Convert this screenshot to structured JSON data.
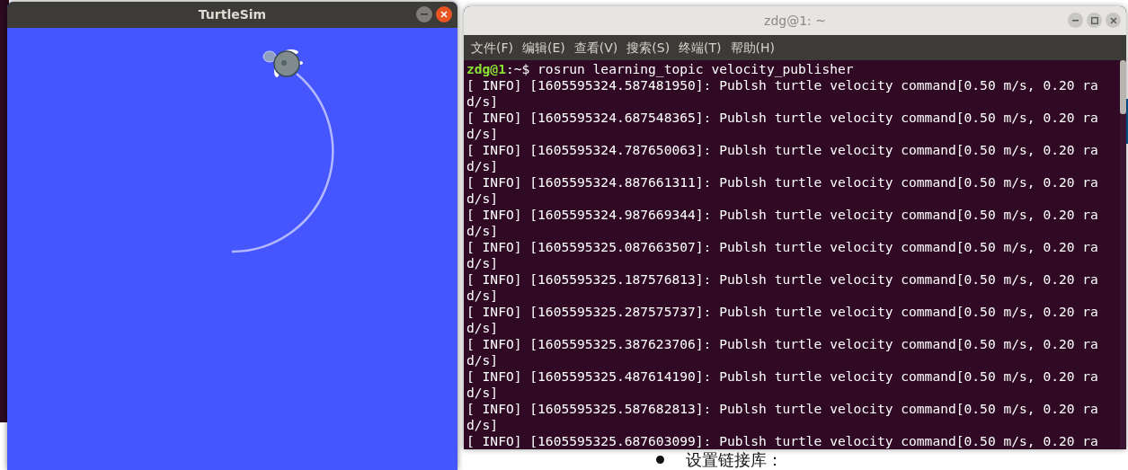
{
  "turtlesim_window": {
    "title": "TurtleSim",
    "active": true
  },
  "terminal_window": {
    "title": "zdg@1: ~",
    "active": false,
    "menu": [
      "文件(F)",
      "编辑(E)",
      "查看(V)",
      "搜索(S)",
      "终端(T)",
      "帮助(H)"
    ],
    "prompt": {
      "user_host": "zdg@1",
      "path": ":~$",
      "command": "rosrun learning_topic velocity_publisher"
    },
    "log_lines": [
      "[ INFO] [1605595324.587481950]: Publsh turtle velocity command[0.50 m/s, 0.20 rad/s]",
      "[ INFO] [1605595324.687548365]: Publsh turtle velocity command[0.50 m/s, 0.20 rad/s]",
      "[ INFO] [1605595324.787650063]: Publsh turtle velocity command[0.50 m/s, 0.20 rad/s]",
      "[ INFO] [1605595324.887661311]: Publsh turtle velocity command[0.50 m/s, 0.20 rad/s]",
      "[ INFO] [1605595324.987669344]: Publsh turtle velocity command[0.50 m/s, 0.20 rad/s]",
      "[ INFO] [1605595325.087663507]: Publsh turtle velocity command[0.50 m/s, 0.20 rad/s]",
      "[ INFO] [1605595325.187576813]: Publsh turtle velocity command[0.50 m/s, 0.20 rad/s]",
      "[ INFO] [1605595325.287575737]: Publsh turtle velocity command[0.50 m/s, 0.20 rad/s]",
      "[ INFO] [1605595325.387623706]: Publsh turtle velocity command[0.50 m/s, 0.20 rad/s]",
      "[ INFO] [1605595325.487614190]: Publsh turtle velocity command[0.50 m/s, 0.20 rad/s]",
      "[ INFO] [1605595325.587682813]: Publsh turtle velocity command[0.50 m/s, 0.20 rad/s]",
      "[ INFO] [1605595325.687603099]: Publsh turtle velocity command[0.50 m/s, 0.20 ra"
    ]
  },
  "background_page": {
    "bullet_text": "设置链接库："
  }
}
